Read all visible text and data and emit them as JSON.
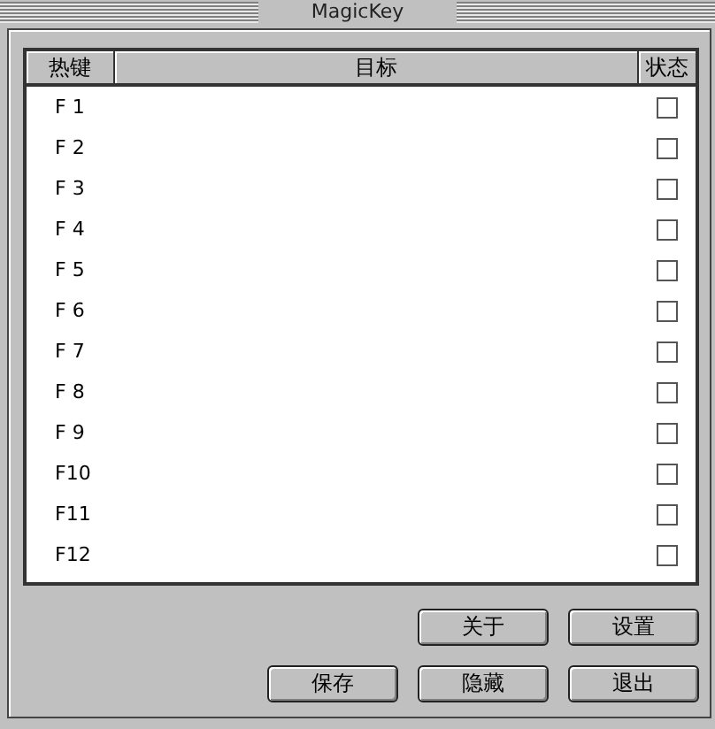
{
  "window": {
    "title": "MagicKey"
  },
  "table": {
    "columns": [
      "热键",
      "目标",
      "状态"
    ],
    "rows": [
      {
        "hotkey": "F 1",
        "checked": false
      },
      {
        "hotkey": "F 2",
        "checked": false
      },
      {
        "hotkey": "F 3",
        "checked": false
      },
      {
        "hotkey": "F 4",
        "checked": false
      },
      {
        "hotkey": "F 5",
        "checked": false
      },
      {
        "hotkey": "F 6",
        "checked": false
      },
      {
        "hotkey": "F 7",
        "checked": false
      },
      {
        "hotkey": "F 8",
        "checked": false
      },
      {
        "hotkey": "F 9",
        "checked": false
      },
      {
        "hotkey": "F10",
        "checked": false
      },
      {
        "hotkey": "F11",
        "checked": false
      },
      {
        "hotkey": "F12",
        "checked": false
      }
    ]
  },
  "buttons": [
    [
      "关于",
      "设置"
    ],
    [
      "保存",
      "隐藏",
      "退出"
    ]
  ]
}
